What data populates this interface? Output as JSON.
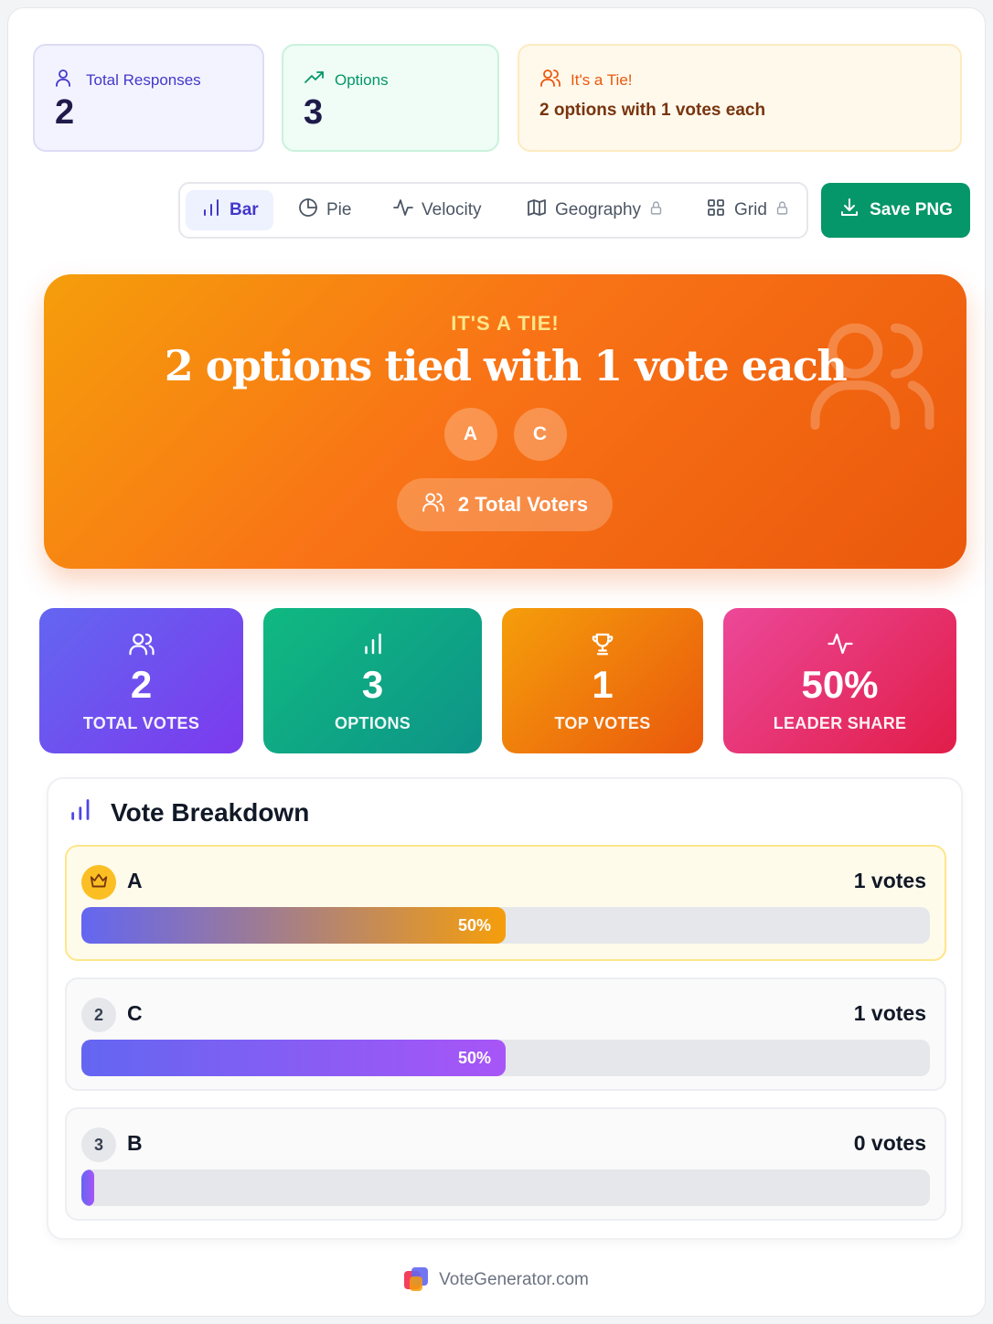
{
  "summary": {
    "responses": {
      "label": "Total Responses",
      "value": "2"
    },
    "options": {
      "label": "Options",
      "value": "3"
    },
    "tie": {
      "label": "It's a Tie!",
      "text": "2 options with 1 votes each"
    }
  },
  "toolbar": {
    "tabs": [
      {
        "label": "Bar",
        "icon": "bar-chart-icon",
        "active": true
      },
      {
        "label": "Pie",
        "icon": "pie-chart-icon"
      },
      {
        "label": "Velocity",
        "icon": "activity-icon"
      },
      {
        "label": "Geography",
        "icon": "map-icon",
        "locked": true
      },
      {
        "label": "Grid",
        "icon": "grid-icon",
        "locked": true
      }
    ],
    "save_label": "Save PNG"
  },
  "hero": {
    "kicker": "IT'S A TIE!",
    "title": "2 options tied with 1 vote each",
    "chips": [
      "A",
      "C"
    ],
    "voters": "2 Total Voters"
  },
  "stats": [
    {
      "value": "2",
      "label": "TOTAL VOTES",
      "icon": "users-icon"
    },
    {
      "value": "3",
      "label": "OPTIONS",
      "icon": "bar-chart-icon"
    },
    {
      "value": "1",
      "label": "TOP VOTES",
      "icon": "trophy-icon"
    },
    {
      "value": "50%",
      "label": "LEADER SHARE",
      "icon": "activity-icon"
    }
  ],
  "breakdown": {
    "title": "Vote Breakdown",
    "rows": [
      {
        "rank": "",
        "name": "A",
        "votes": "1 votes",
        "percent_label": "50%",
        "share": 0.5,
        "leader": true
      },
      {
        "rank": "2",
        "name": "C",
        "votes": "1 votes",
        "percent_label": "50%",
        "share": 0.5
      },
      {
        "rank": "3",
        "name": "B",
        "votes": "0 votes",
        "percent_label": "",
        "share": 0
      }
    ]
  },
  "footer": {
    "brand": "VoteGenerator.com"
  },
  "colors": {
    "accent": "#4338ca",
    "save": "#059669",
    "hero": "#f97316",
    "leader_bg": "#fffbeb"
  }
}
